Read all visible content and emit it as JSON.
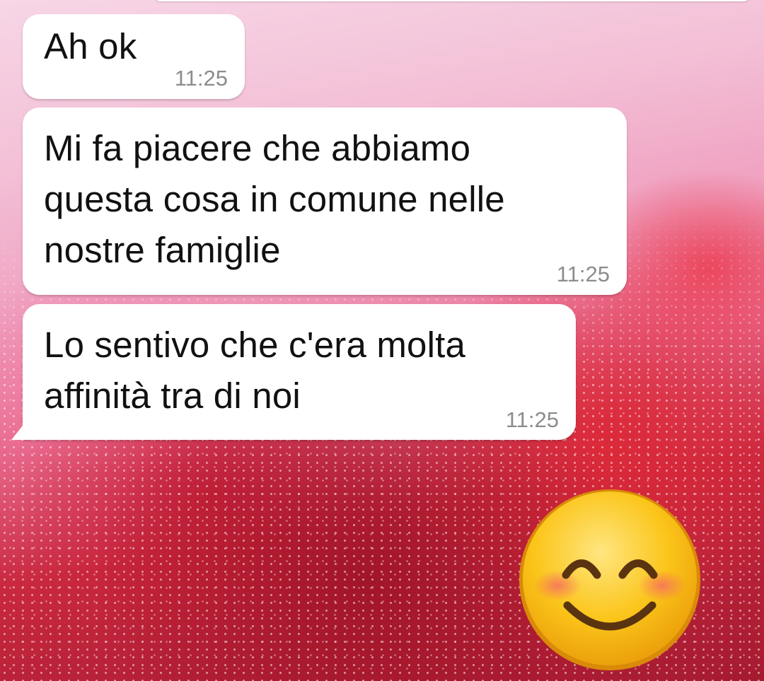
{
  "chat": {
    "messages": [
      {
        "text": "Ah ok",
        "time": "11:25"
      },
      {
        "text": "Mi fa piacere che abbiamo\nquesta cosa in comune nelle\nnostre famiglie",
        "time": "11:25"
      },
      {
        "text": "Lo sentivo che c'era molta\naffinità tra di noi",
        "time": "11:25"
      }
    ],
    "sticker": {
      "icon": "smiling-face-with-smiling-eyes-icon"
    }
  },
  "colors": {
    "bubble": "#ffffff",
    "timestamp": "#8c8c8c",
    "text": "#111111",
    "emoji_face": "#f9c21b"
  }
}
